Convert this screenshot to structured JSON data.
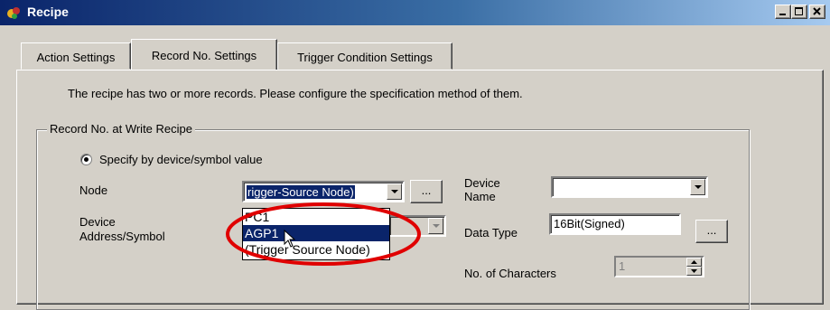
{
  "window": {
    "title": "Recipe"
  },
  "tabs": [
    {
      "label": "Action Settings"
    },
    {
      "label": "Record No. Settings"
    },
    {
      "label": "Trigger Condition Settings"
    }
  ],
  "description": "The recipe has two or more records. Please configure the specification method of them.",
  "group": {
    "title": "Record No. at Write Recipe",
    "radio_label": "Specify by device/symbol value",
    "node_label": "Node",
    "node_value": "rigger-Source Node)",
    "browse_label": "...",
    "device_address_label_1": "Device",
    "device_address_label_2": "Address/Symbol",
    "device_name_label_1": "Device",
    "device_name_label_2": "Name",
    "device_name_value": "",
    "data_type_label": "Data Type",
    "data_type_value": "16Bit(Signed)",
    "data_type_browse": "...",
    "chars_label": "No. of Characters",
    "chars_value": "1"
  },
  "node_options": [
    "PC1",
    "AGP1",
    "(Trigger Source Node)"
  ],
  "node_highlighted": "AGP1",
  "colors": {
    "highlight": "#0a246a",
    "annotation": "#e00000",
    "face": "#d4d0c8"
  }
}
